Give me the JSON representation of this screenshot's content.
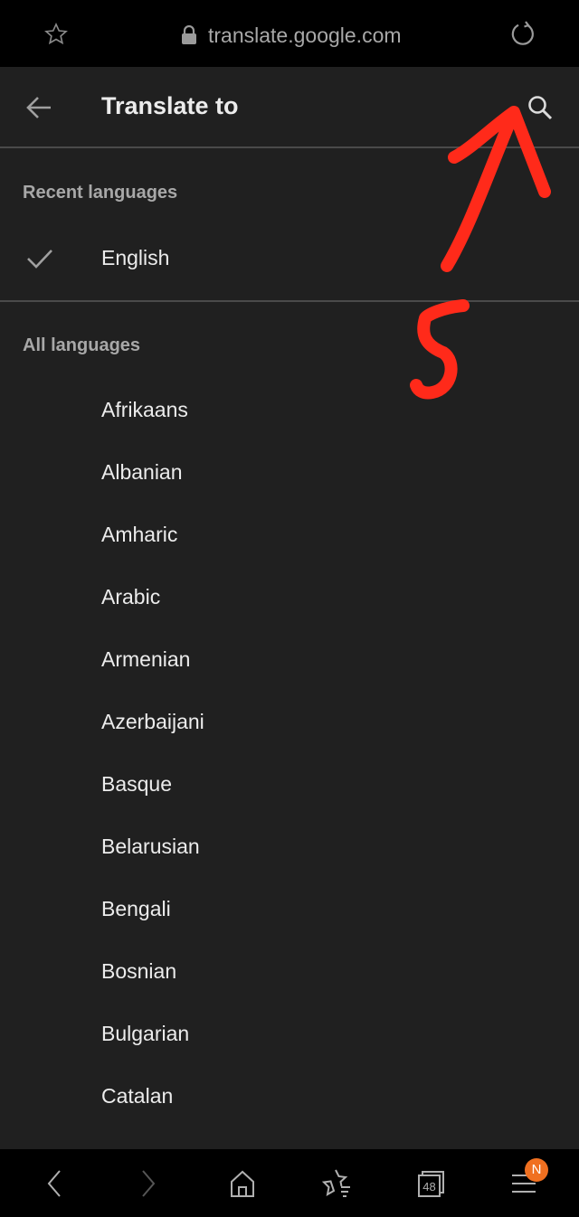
{
  "browser": {
    "url": "translate.google.com",
    "icons": [
      "star-icon",
      "lock-icon",
      "reload-icon"
    ]
  },
  "appbar": {
    "title": "Translate to",
    "icons": [
      "back-arrow-icon",
      "search-icon"
    ]
  },
  "recent": {
    "label": "Recent languages",
    "items": [
      {
        "label": "English",
        "selected": true
      }
    ]
  },
  "all": {
    "label": "All languages",
    "items": [
      "Afrikaans",
      "Albanian",
      "Amharic",
      "Arabic",
      "Armenian",
      "Azerbaijani",
      "Basque",
      "Belarusian",
      "Bengali",
      "Bosnian",
      "Bulgarian",
      "Catalan"
    ]
  },
  "bottom_nav": {
    "tabs_count": "48",
    "menu_badge": "N",
    "badge_color": "#f07020"
  },
  "annotation": {
    "text": "5",
    "color": "#ff2a1a"
  }
}
